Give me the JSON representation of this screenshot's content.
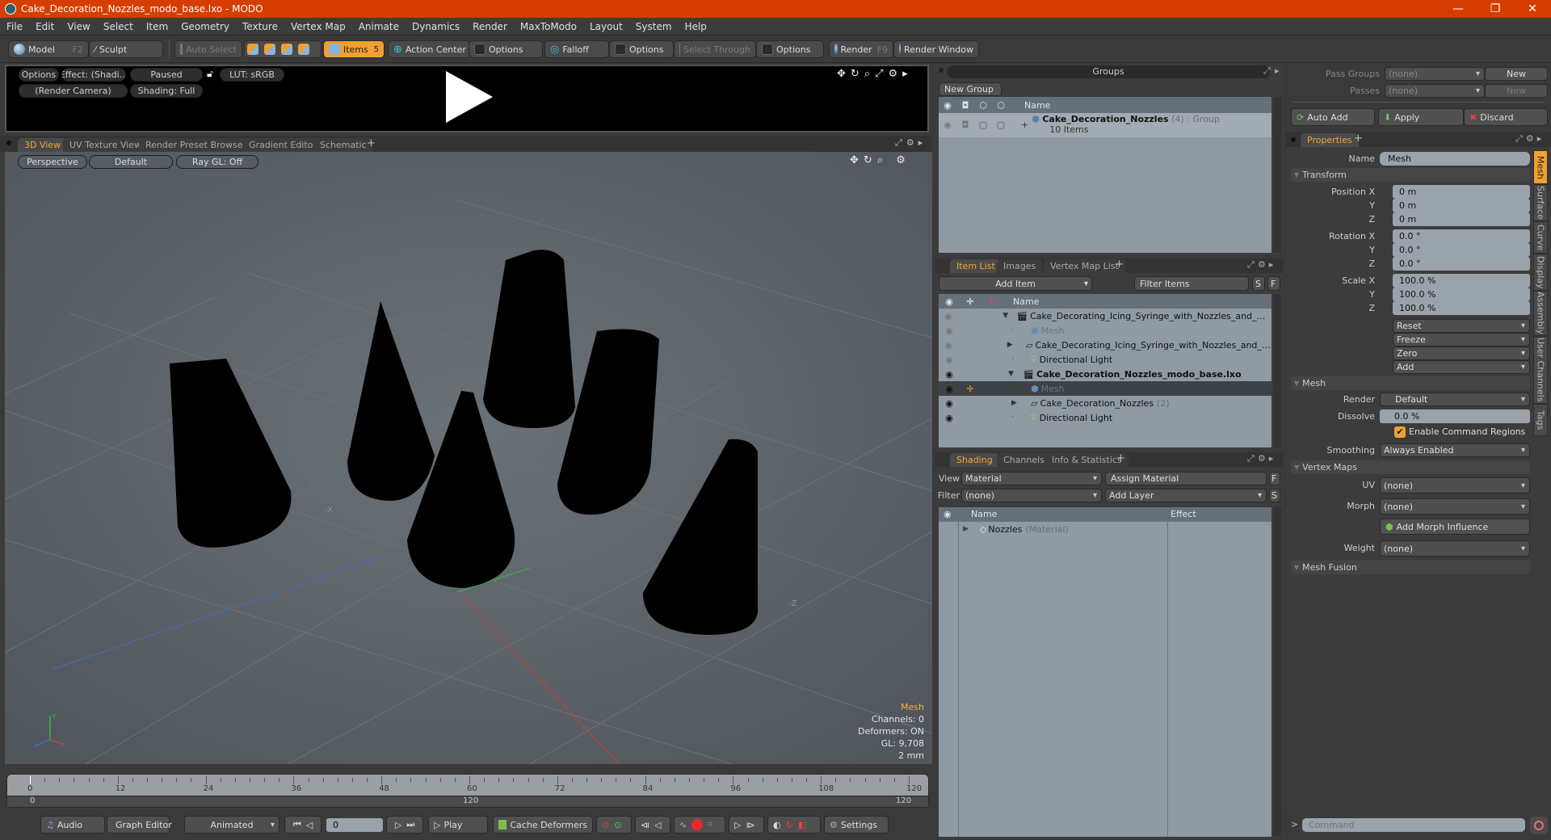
{
  "window": {
    "title": "Cake_Decoration_Nozzles_modo_base.lxo - MODO",
    "controls": {
      "minimize": "—",
      "restore": "❐",
      "close": "✕"
    }
  },
  "menu": [
    "File",
    "Edit",
    "View",
    "Select",
    "Item",
    "Geometry",
    "Texture",
    "Vertex Map",
    "Animate",
    "Dynamics",
    "Render",
    "MaxToModo",
    "Layout",
    "System",
    "Help"
  ],
  "toolbar": {
    "model": "Model",
    "model_key": "F2",
    "sculpt": "Sculpt",
    "auto_select": "Auto Select",
    "items": "Items",
    "items_key": "5",
    "action_center": "Action Center",
    "options1": "Options",
    "falloff": "Falloff",
    "options2": "Options",
    "select_through": "Select Through",
    "options3": "Options",
    "render": "Render",
    "render_key": "F9",
    "render_window": "Render Window"
  },
  "preview": {
    "options": "Options",
    "effect": "Effect: (Shadi...",
    "paused": "Paused",
    "lut": "LUT: sRGB",
    "camera": "(Render Camera)",
    "shading": "Shading: Full"
  },
  "viewport": {
    "tabs": [
      "3D View",
      "UV Texture View",
      "Render Preset Browser",
      "Gradient Editor",
      "Schematic"
    ],
    "active_tab": "3D View",
    "add_tab": "+",
    "perspective": "Perspective",
    "default": "Default",
    "raygl": "Ray GL: Off",
    "info": {
      "selection": "Mesh",
      "channels": "Channels: 0",
      "deformers": "Deformers: ON",
      "gl": "GL: 9,708",
      "unit": "2 mm"
    },
    "axis_labels": {
      "x": "-X",
      "z": "-Z"
    }
  },
  "timeline": {
    "ticks": [
      "0",
      "12",
      "24",
      "36",
      "48",
      "60",
      "72",
      "84",
      "96",
      "108",
      "120"
    ],
    "range_start": "0",
    "range_mid": "120",
    "range_end": "120"
  },
  "transport": {
    "audio": "Audio",
    "graph_editor": "Graph Editor",
    "animated": "Animated",
    "frame": "0",
    "play": "Play",
    "cache_deformers": "Cache Deformers",
    "settings": "Settings"
  },
  "groups": {
    "title": "Groups",
    "new_group": "New Group",
    "col_name": "Name",
    "row": {
      "name": "Cake_Decoration_Nozzles",
      "count": "(4)",
      "type": ": Group",
      "sub": "10 Items"
    }
  },
  "itemlist": {
    "tabs": [
      "Item List",
      "Images",
      "Vertex Map List"
    ],
    "add_item": "Add Item",
    "filter": "Filter Items",
    "s": "S",
    "f": "F",
    "col_name": "Name",
    "rows": [
      {
        "label": "Cake_Decorating_Icing_Syringe_with_Nozzles_and_Cream...",
        "indent": 0,
        "kind": "scene",
        "dim": false,
        "bold": false
      },
      {
        "label": "Mesh",
        "indent": 1,
        "kind": "mesh",
        "dim": true,
        "bold": false
      },
      {
        "label": "Cake_Decorating_Icing_Syringe_with_Nozzles_and_Cre ...",
        "indent": 1,
        "kind": "group",
        "dim": false,
        "bold": false
      },
      {
        "label": "Directional Light",
        "indent": 1,
        "kind": "light",
        "dim": false,
        "bold": false
      },
      {
        "label": "Cake_Decoration_Nozzles_modo_base.lxo",
        "indent": 0,
        "kind": "scene",
        "dim": false,
        "bold": true
      },
      {
        "label": "Mesh",
        "indent": 1,
        "kind": "mesh",
        "dim": true,
        "bold": false,
        "selected": true
      },
      {
        "label": "Cake_Decoration_Nozzles",
        "count": "(2)",
        "indent": 1,
        "kind": "group",
        "dim": false,
        "bold": false
      },
      {
        "label": "Directional Light",
        "indent": 1,
        "kind": "light",
        "dim": false,
        "bold": false
      }
    ]
  },
  "shading": {
    "tabs": [
      "Shading",
      "Channels",
      "Info & Statistics"
    ],
    "view_label": "View",
    "view_value": "Material",
    "assign_material": "Assign Material",
    "f": "F",
    "filter_label": "Filter",
    "filter_value": "(none)",
    "add_layer": "Add Layer",
    "s": "S",
    "col_name": "Name",
    "col_effect": "Effect",
    "row": {
      "name": "Nozzles",
      "type": "(Material)"
    }
  },
  "passes": {
    "pass_groups": "Pass Groups",
    "pass_groups_value": "(none)",
    "new1": "New",
    "passes": "Passes",
    "passes_value": "(none)",
    "new2": "New",
    "auto_add": "Auto Add",
    "apply": "Apply",
    "discard": "Discard"
  },
  "properties": {
    "tab": "Properties",
    "name_label": "Name",
    "name_value": "Mesh",
    "transform": "Transform",
    "position": {
      "label": "Position X",
      "x": "0 m",
      "y": "0 m",
      "z": "0 m"
    },
    "rotation": {
      "label": "Rotation X",
      "x": "0.0 °",
      "y": "0.0 °",
      "z": "0.0 °"
    },
    "scale": {
      "label": "Scale X",
      "x": "100.0 %",
      "y": "100.0 %",
      "z": "100.0 %"
    },
    "axis_y": "Y",
    "axis_z": "Z",
    "actions": [
      "Reset",
      "Freeze",
      "Zero",
      "Add"
    ],
    "mesh": "Mesh",
    "render_label": "Render",
    "render_value": "Default",
    "dissolve_label": "Dissolve",
    "dissolve_value": "0.0 %",
    "enable_cmd": "Enable Command Regions",
    "smoothing_label": "Smoothing",
    "smoothing_value": "Always Enabled",
    "vertex_maps": "Vertex Maps",
    "uv_label": "UV",
    "uv_value": "(none)",
    "morph_label": "Morph",
    "morph_value": "(none)",
    "add_morph": "Add Morph Influence",
    "weight_label": "Weight",
    "weight_value": "(none)",
    "mesh_fusion": "Mesh Fusion",
    "side_tabs": [
      "Mesh",
      "Surface",
      "Curve",
      "Display",
      "Assembly",
      "User Channels",
      "Tags"
    ]
  },
  "command": {
    "prompt": ">",
    "placeholder": "Command"
  }
}
